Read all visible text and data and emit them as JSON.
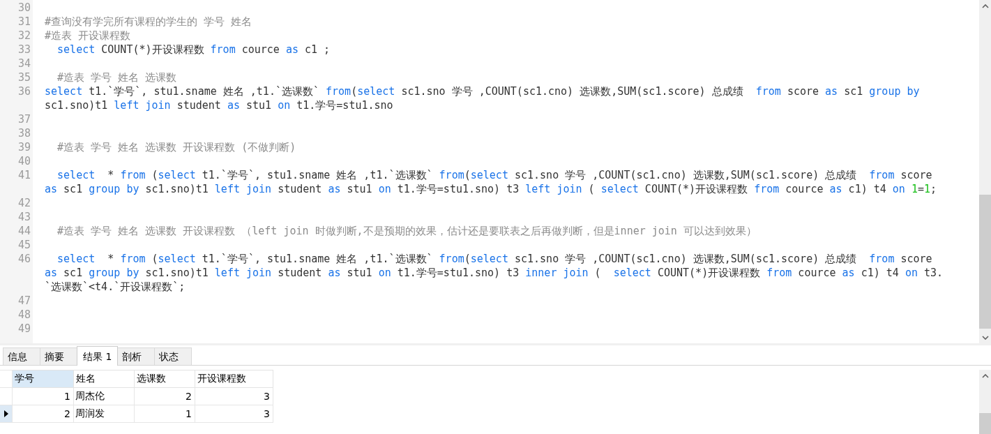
{
  "editor": {
    "lines": [
      {
        "number": "30"
      },
      {
        "number": "31",
        "rows": [
          {
            "segments": [
              {
                "kind": "comment",
                "text": "#查询没有学完所有课程的学生的 学号 姓名"
              }
            ]
          }
        ]
      },
      {
        "number": "32",
        "rows": [
          {
            "segments": [
              {
                "kind": "comment",
                "text": "#造表 开设课程数"
              }
            ]
          }
        ]
      },
      {
        "number": "33",
        "rows": [
          {
            "segments": [
              {
                "kind": "keyword",
                "text": "  select"
              },
              {
                "kind": "plain",
                "text": " COUNT(*)开设课程数 "
              },
              {
                "kind": "keyword",
                "text": "from"
              },
              {
                "kind": "plain",
                "text": " cource "
              },
              {
                "kind": "keyword",
                "text": "as"
              },
              {
                "kind": "plain",
                "text": " c1 ;"
              }
            ]
          }
        ]
      },
      {
        "number": "34"
      },
      {
        "number": "35",
        "rows": [
          {
            "segments": [
              {
                "kind": "comment",
                "text": "  #造表 学号 姓名 选课数"
              }
            ]
          }
        ]
      },
      {
        "number": "36",
        "rows": [
          {
            "segments": [
              {
                "kind": "keyword",
                "text": "select"
              },
              {
                "kind": "plain",
                "text": " t1.`学号`, stu1.sname 姓名 ,t1.`选课数` "
              },
              {
                "kind": "keyword",
                "text": "from"
              },
              {
                "kind": "plain",
                "text": "("
              },
              {
                "kind": "keyword",
                "text": "select"
              },
              {
                "kind": "plain",
                "text": " sc1.sno 学号 ,COUNT(sc1.cno) 选课数,SUM(sc1.score) 总成绩  "
              },
              {
                "kind": "keyword",
                "text": "from"
              },
              {
                "kind": "plain",
                "text": " score "
              },
              {
                "kind": "keyword",
                "text": "as"
              },
              {
                "kind": "plain",
                "text": " sc1 "
              },
              {
                "kind": "keyword",
                "text": "group by"
              }
            ]
          },
          {
            "segments": [
              {
                "kind": "plain",
                "text": "sc1.sno)t1 "
              },
              {
                "kind": "keyword",
                "text": "left join"
              },
              {
                "kind": "plain",
                "text": " student "
              },
              {
                "kind": "keyword",
                "text": "as"
              },
              {
                "kind": "plain",
                "text": " stu1 "
              },
              {
                "kind": "keyword",
                "text": "on"
              },
              {
                "kind": "plain",
                "text": " t1.学号=stu1.sno"
              }
            ]
          }
        ]
      },
      {
        "number": "37"
      },
      {
        "number": "38"
      },
      {
        "number": "39",
        "rows": [
          {
            "segments": [
              {
                "kind": "comment",
                "text": "  #造表 学号 姓名 选课数 开设课程数 (不做判断)"
              }
            ]
          }
        ]
      },
      {
        "number": "40"
      },
      {
        "number": "41",
        "rows": [
          {
            "segments": [
              {
                "kind": "keyword",
                "text": "  select"
              },
              {
                "kind": "plain",
                "text": "  * "
              },
              {
                "kind": "keyword",
                "text": "from"
              },
              {
                "kind": "plain",
                "text": " ("
              },
              {
                "kind": "keyword",
                "text": "select"
              },
              {
                "kind": "plain",
                "text": " t1.`学号`, stu1.sname 姓名 ,t1.`选课数` "
              },
              {
                "kind": "keyword",
                "text": "from"
              },
              {
                "kind": "plain",
                "text": "("
              },
              {
                "kind": "keyword",
                "text": "select"
              },
              {
                "kind": "plain",
                "text": " sc1.sno 学号 ,COUNT(sc1.cno) 选课数,SUM(sc1.score) 总成绩  "
              },
              {
                "kind": "keyword",
                "text": "from"
              },
              {
                "kind": "plain",
                "text": " score"
              }
            ]
          },
          {
            "segments": [
              {
                "kind": "keyword",
                "text": "as"
              },
              {
                "kind": "plain",
                "text": " sc1 "
              },
              {
                "kind": "keyword",
                "text": "group by"
              },
              {
                "kind": "plain",
                "text": " sc1.sno)t1 "
              },
              {
                "kind": "keyword",
                "text": "left join"
              },
              {
                "kind": "plain",
                "text": " student "
              },
              {
                "kind": "keyword",
                "text": "as"
              },
              {
                "kind": "plain",
                "text": " stu1 "
              },
              {
                "kind": "keyword",
                "text": "on"
              },
              {
                "kind": "plain",
                "text": " t1.学号=stu1.sno) t3 "
              },
              {
                "kind": "keyword",
                "text": "left join"
              },
              {
                "kind": "plain",
                "text": " ( "
              },
              {
                "kind": "keyword",
                "text": "select"
              },
              {
                "kind": "plain",
                "text": " COUNT(*)开设课程数 "
              },
              {
                "kind": "keyword",
                "text": "from"
              },
              {
                "kind": "plain",
                "text": " cource "
              },
              {
                "kind": "keyword",
                "text": "as"
              },
              {
                "kind": "plain",
                "text": " c1) t4 "
              },
              {
                "kind": "keyword",
                "text": "on "
              },
              {
                "kind": "number",
                "text": "1"
              },
              {
                "kind": "plain",
                "text": "="
              },
              {
                "kind": "number",
                "text": "1"
              },
              {
                "kind": "plain",
                "text": ";"
              }
            ]
          }
        ]
      },
      {
        "number": "42"
      },
      {
        "number": "43"
      },
      {
        "number": "44",
        "rows": [
          {
            "segments": [
              {
                "kind": "comment",
                "text": "  #造表 学号 姓名 选课数 开设课程数 （left join 时做判断,不是预期的效果，估计还是要联表之后再做判断，但是inner join 可以达到效果）"
              }
            ]
          }
        ]
      },
      {
        "number": "45"
      },
      {
        "number": "46",
        "rows": [
          {
            "segments": [
              {
                "kind": "keyword",
                "text": "  select"
              },
              {
                "kind": "plain",
                "text": "  * "
              },
              {
                "kind": "keyword",
                "text": "from"
              },
              {
                "kind": "plain",
                "text": " ("
              },
              {
                "kind": "keyword",
                "text": "select"
              },
              {
                "kind": "plain",
                "text": " t1.`学号`, stu1.sname 姓名 ,t1.`选课数` "
              },
              {
                "kind": "keyword",
                "text": "from"
              },
              {
                "kind": "plain",
                "text": "("
              },
              {
                "kind": "keyword",
                "text": "select"
              },
              {
                "kind": "plain",
                "text": " sc1.sno 学号 ,COUNT(sc1.cno) 选课数,SUM(sc1.score) 总成绩  "
              },
              {
                "kind": "keyword",
                "text": "from"
              },
              {
                "kind": "plain",
                "text": " score"
              }
            ]
          },
          {
            "segments": [
              {
                "kind": "keyword",
                "text": "as"
              },
              {
                "kind": "plain",
                "text": " sc1 "
              },
              {
                "kind": "keyword",
                "text": "group by"
              },
              {
                "kind": "plain",
                "text": " sc1.sno)t1 "
              },
              {
                "kind": "keyword",
                "text": "left join"
              },
              {
                "kind": "plain",
                "text": " student "
              },
              {
                "kind": "keyword",
                "text": "as"
              },
              {
                "kind": "plain",
                "text": " stu1 "
              },
              {
                "kind": "keyword",
                "text": "on"
              },
              {
                "kind": "plain",
                "text": " t1.学号=stu1.sno) t3 "
              },
              {
                "kind": "keyword",
                "text": "inner join"
              },
              {
                "kind": "plain",
                "text": " (  "
              },
              {
                "kind": "keyword",
                "text": "select"
              },
              {
                "kind": "plain",
                "text": " COUNT(*)开设课程数 "
              },
              {
                "kind": "keyword",
                "text": "from"
              },
              {
                "kind": "plain",
                "text": " cource "
              },
              {
                "kind": "keyword",
                "text": "as"
              },
              {
                "kind": "plain",
                "text": " c1) t4 "
              },
              {
                "kind": "keyword",
                "text": "on"
              },
              {
                "kind": "plain",
                "text": " t3."
              }
            ]
          },
          {
            "segments": [
              {
                "kind": "plain",
                "text": "`选课数`<t4.`开设课程数`;"
              }
            ]
          }
        ]
      },
      {
        "number": "47"
      },
      {
        "number": "48"
      },
      {
        "number": "49"
      }
    ]
  },
  "result_tabs": [
    {
      "label": "信息",
      "selected": false
    },
    {
      "label": "摘要",
      "selected": false
    },
    {
      "label": "结果 1",
      "selected": true
    },
    {
      "label": "剖析",
      "selected": false
    },
    {
      "label": "状态",
      "selected": false
    }
  ],
  "result_grid": {
    "columns": [
      {
        "label": "学号",
        "kind": "number",
        "selected": true
      },
      {
        "label": "姓名",
        "kind": "text",
        "selected": false
      },
      {
        "label": "选课数",
        "kind": "number",
        "selected": false
      },
      {
        "label": "开设课程数",
        "kind": "number",
        "selected": false
      }
    ],
    "rows": [
      {
        "current": false,
        "cells": [
          "1",
          "周杰伦",
          "2",
          "3"
        ]
      },
      {
        "current": true,
        "cells": [
          "2",
          "周润发",
          "1",
          "3"
        ]
      }
    ]
  }
}
